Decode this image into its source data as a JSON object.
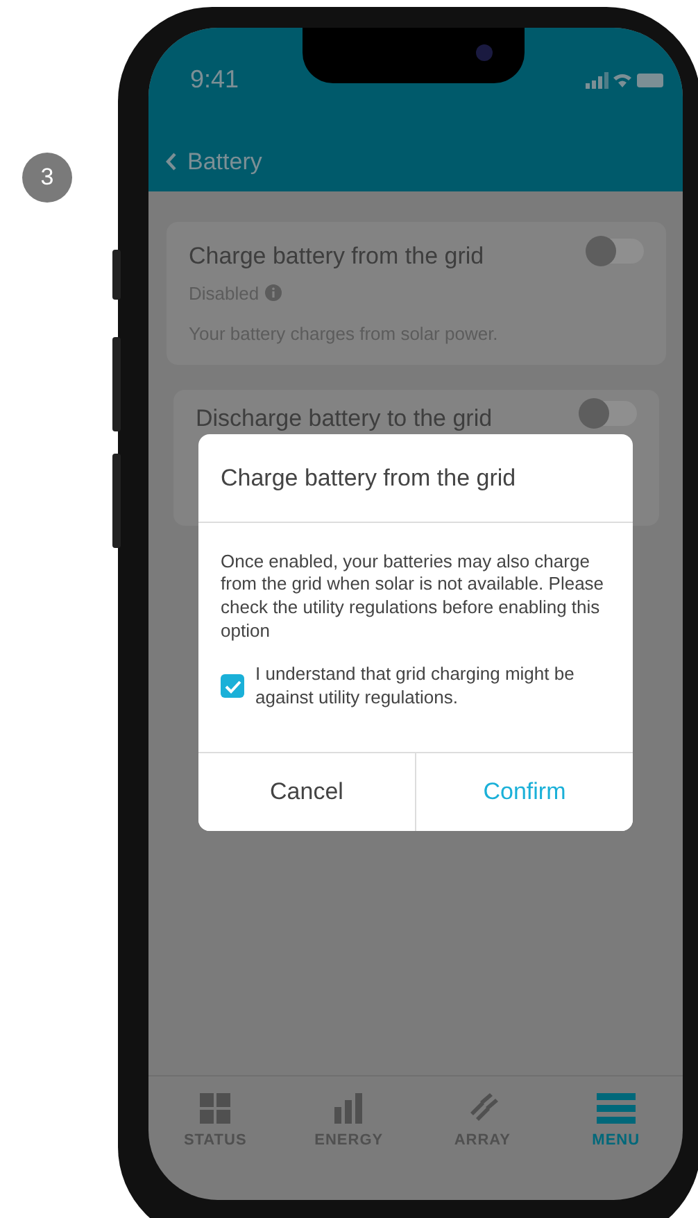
{
  "step_badge": "3",
  "status_bar": {
    "time": "9:41"
  },
  "header": {
    "back_label": "Battery"
  },
  "settings": [
    {
      "title": "Charge battery from the grid",
      "status": "Disabled",
      "description": "Your battery charges from solar power.",
      "on": false
    },
    {
      "title": "Discharge battery to the grid",
      "on": false
    }
  ],
  "dialog": {
    "title": "Charge battery from the grid",
    "message": "Once enabled, your batteries may also charge from the grid when solar is not available. Please check the utility regulations before enabling this option",
    "checkbox": {
      "label": "I understand that grid charging might be against utility regulations.",
      "checked": true
    },
    "buttons": [
      {
        "label": "Cancel",
        "kind": "secondary"
      },
      {
        "label": "Confirm",
        "kind": "primary"
      }
    ]
  },
  "tab_bar": [
    {
      "label": "STATUS",
      "kind": "grid",
      "selected": false
    },
    {
      "label": "ENERGY",
      "kind": "bars",
      "selected": false
    },
    {
      "label": "ARRAY",
      "kind": "panels",
      "selected": false
    },
    {
      "label": "MENU",
      "kind": "menu",
      "selected": true
    }
  ]
}
